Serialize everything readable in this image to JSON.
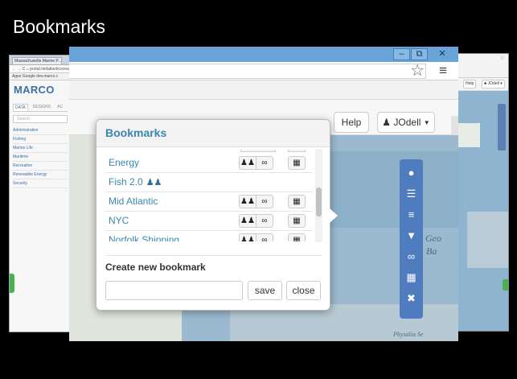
{
  "slide": {
    "title": "Bookmarks"
  },
  "bg_left": {
    "tab_label": "Massachusetts Marine P... ×",
    "address": "← → C  ⌂ portal.midatlanticocean.org",
    "bookmarks_bar": "Apps  Google  dev.marco.c",
    "logo": "MARCO",
    "tabs": [
      "DATA",
      "DESIGNS",
      "AC"
    ],
    "search_placeholder": "Search",
    "themes": [
      "Administrative",
      "Fishing",
      "Marine Life",
      "Maritime",
      "Recreation",
      "Renewable Energy",
      "Security"
    ]
  },
  "bg_right": {
    "help": "Help",
    "user": "♣ JOdell ▾"
  },
  "window": {
    "minimize": "–",
    "maximize": "⧉",
    "close": "✕",
    "star": "☆",
    "menu": "≡"
  },
  "header": {
    "help_label": "Help",
    "user_name": "JOdell"
  },
  "map": {
    "label_a": "Geo",
    "label_b": "Ba",
    "label_c": "Physalia Se"
  },
  "toolbar_icons": [
    "globe-icon",
    "list-icon",
    "layers-icon",
    "marker-icon",
    "link-icon",
    "print-icon",
    "fullscreen-icon"
  ],
  "modal": {
    "title": "Bookmarks",
    "bookmarks": [
      {
        "name": "Energy",
        "shared": false
      },
      {
        "name": "Fish 2.0",
        "shared": true
      },
      {
        "name": "Mid Atlantic",
        "shared": false
      },
      {
        "name": "NYC",
        "shared": false
      },
      {
        "name": "Norfolk Shipping",
        "shared": false
      }
    ],
    "create_label": "Create new bookmark",
    "input_value": "",
    "save_label": "save",
    "close_label": "close"
  },
  "colors": {
    "accent": "#3a87ad",
    "toolbar": "#4f7bbf",
    "titlebar": "#6aa3d8"
  }
}
